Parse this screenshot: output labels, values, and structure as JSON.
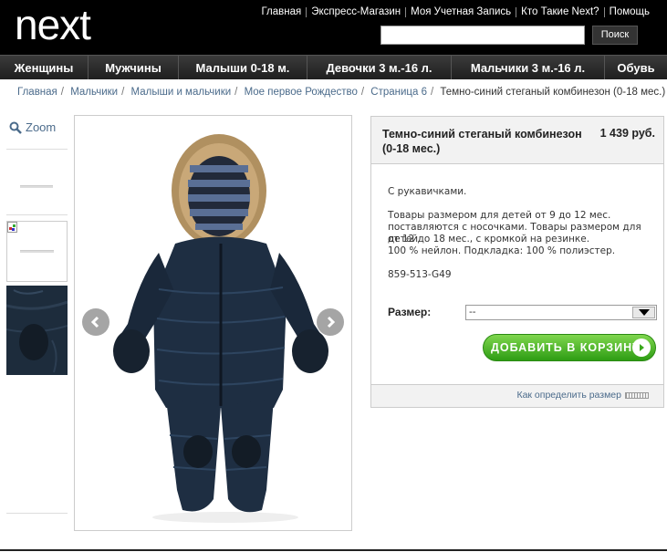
{
  "header": {
    "logo": "next",
    "links": [
      "Главная",
      "Экспресс-Магазин",
      "Моя Учетная Запись",
      "Кто Такие Next?",
      "Помощь"
    ],
    "search_placeholder": "",
    "search_button": "Поиск"
  },
  "nav": {
    "items": [
      "Женщины",
      "Мужчины",
      "Малыши 0-18 м.",
      "Девочки 3 м.-16 л.",
      "Мальчики 3 м.-16 л.",
      "Обувь"
    ]
  },
  "breadcrumb": {
    "items": [
      "Главная",
      "Мальчики",
      "Малыши и мальчики",
      "Мое первое Рождество",
      "Страница 6"
    ],
    "current": "Темно-синий стеганый комбинезон (0-18 мес.)"
  },
  "gallery": {
    "zoom_label": "Zoom"
  },
  "product": {
    "title": "Темно-синий стеганый комбинезон (0-18 мес.)",
    "price": "1 439 руб.",
    "desc_line1": "С рукавичками.",
    "desc_para2": [
      "Товары размером для детей от 9 до 12 мес.",
      "поставляются с носочками. Товары размером для детей",
      "от 12 до 18 мес., с кромкой на резинке.",
      "100 % нейлон. Подкладка: 100 % полиэстер."
    ],
    "sku": "859-513-G49",
    "size_label": "Размер:",
    "size_value": "--",
    "add_to_cart": "ДОБАВИТЬ В КОРЗИНУ",
    "size_guide": "Как определить размер"
  },
  "colors": {
    "header_bg": "#000000",
    "link_blue": "#4b6b8b",
    "cart_green": "#3aa81c"
  }
}
